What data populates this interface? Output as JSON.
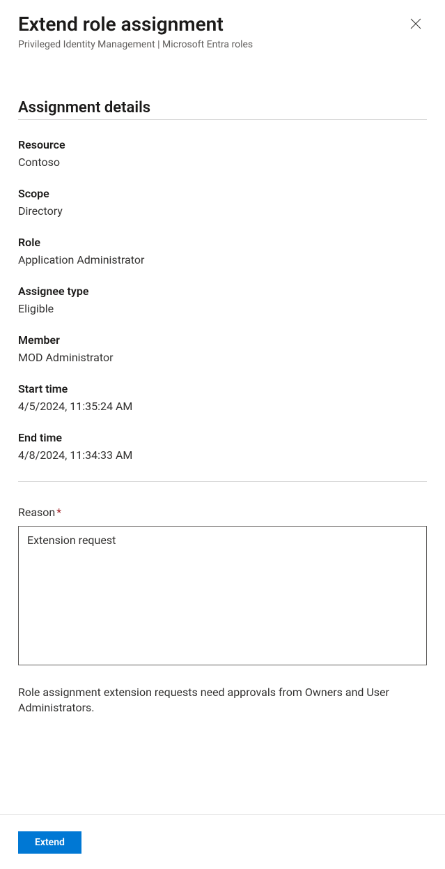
{
  "header": {
    "title": "Extend role assignment",
    "breadcrumb": "Privileged Identity Management | Microsoft Entra roles"
  },
  "section": {
    "heading": "Assignment details",
    "fields": {
      "resource": {
        "label": "Resource",
        "value": "Contoso"
      },
      "scope": {
        "label": "Scope",
        "value": "Directory"
      },
      "role": {
        "label": "Role",
        "value": "Application Administrator"
      },
      "assignee_type": {
        "label": "Assignee type",
        "value": "Eligible"
      },
      "member": {
        "label": "Member",
        "value": "MOD Administrator"
      },
      "start_time": {
        "label": "Start time",
        "value": "4/5/2024, 11:35:24 AM"
      },
      "end_time": {
        "label": "End time",
        "value": "4/8/2024, 11:34:33 AM"
      }
    }
  },
  "reason": {
    "label": "Reason",
    "required_mark": "*",
    "value": "Extension request"
  },
  "info_text": "Role assignment extension requests need approvals from Owners and User Administrators.",
  "footer": {
    "extend_label": "Extend"
  }
}
